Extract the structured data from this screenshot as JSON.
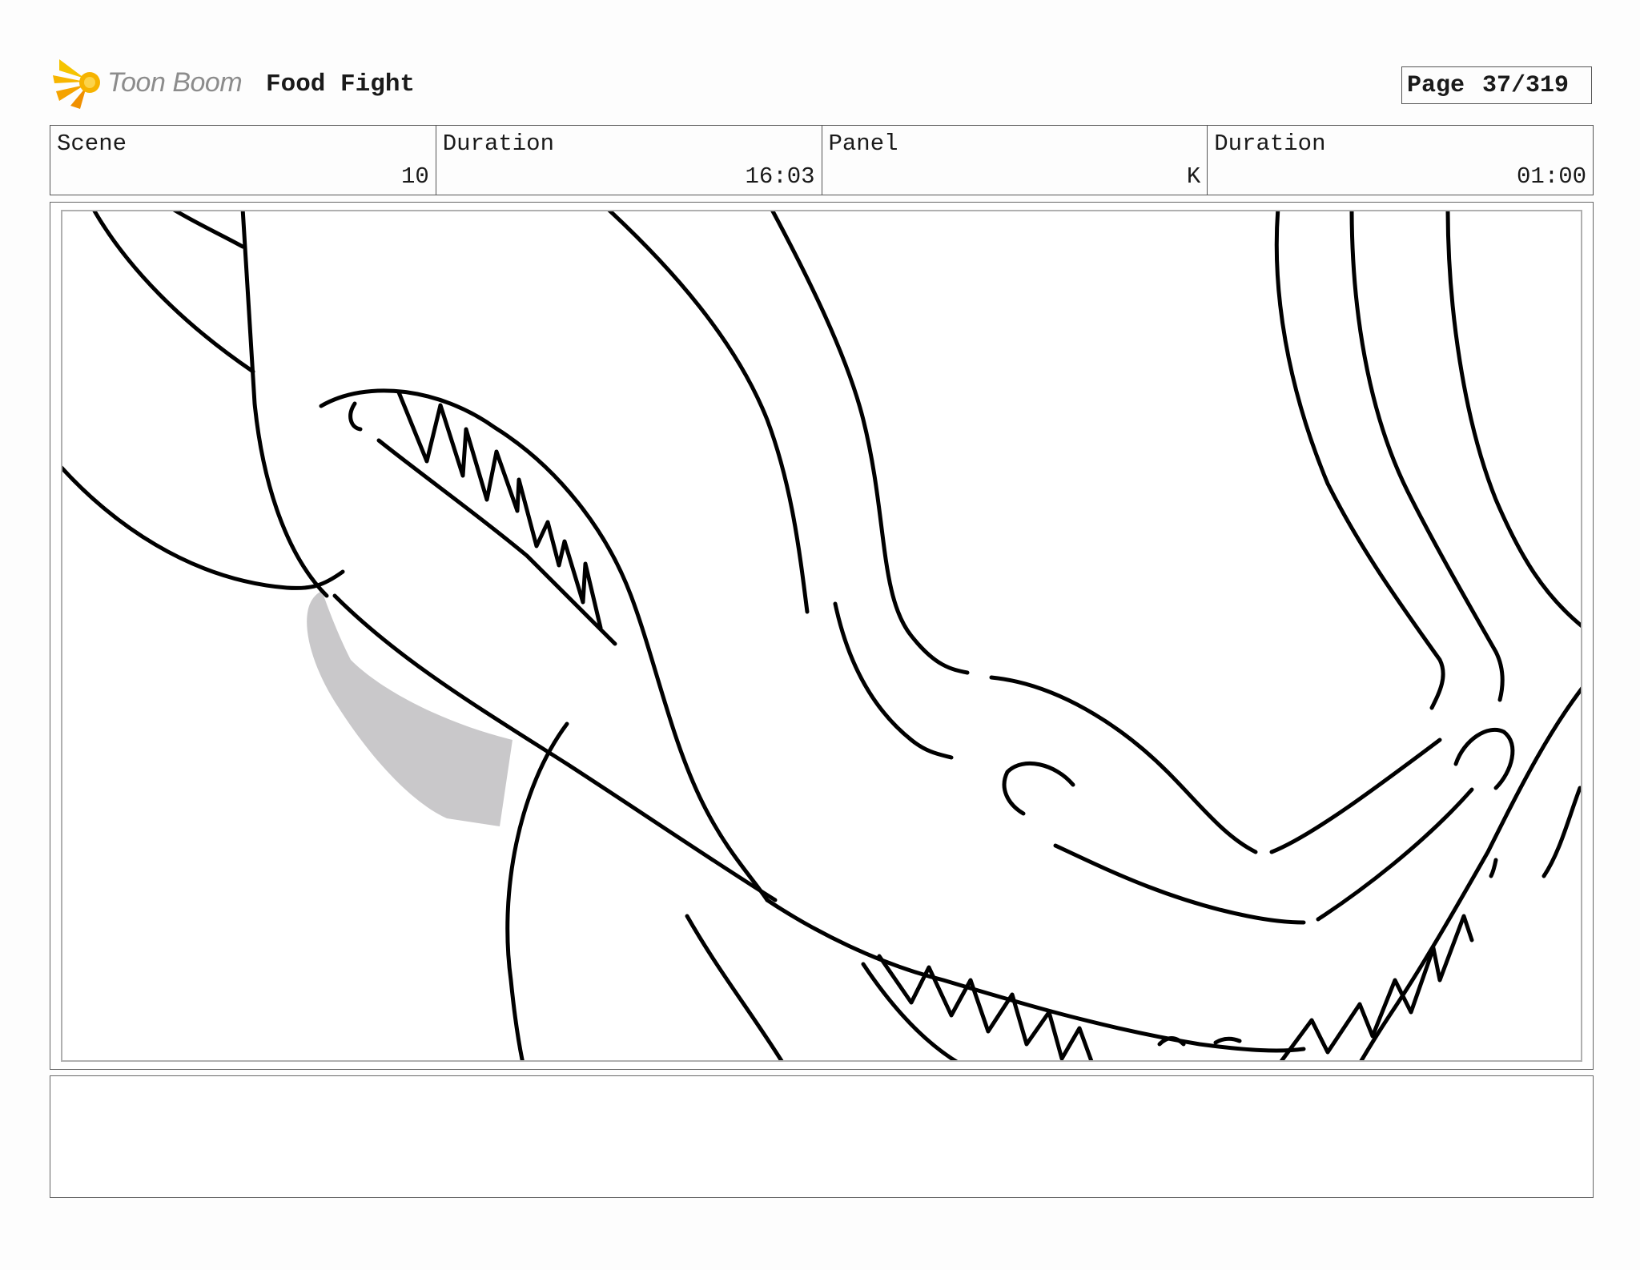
{
  "header": {
    "logo_text": "Toon Boom",
    "project_title": "Food Fight",
    "page_label": "Page",
    "page_value": "37/319"
  },
  "info_bar": {
    "scene_label": "Scene",
    "scene_value": "10",
    "scene_duration_label": "Duration",
    "scene_duration_value": "16:03",
    "panel_label": "Panel",
    "panel_value": "K",
    "panel_duration_label": "Duration",
    "panel_duration_value": "01:00"
  },
  "notes": {
    "text": ""
  },
  "colors": {
    "logo_yellow": "#f5b800",
    "logo_orange": "#f08c00",
    "ink": "#000000",
    "shadow_fill": "#c9c8ca"
  }
}
